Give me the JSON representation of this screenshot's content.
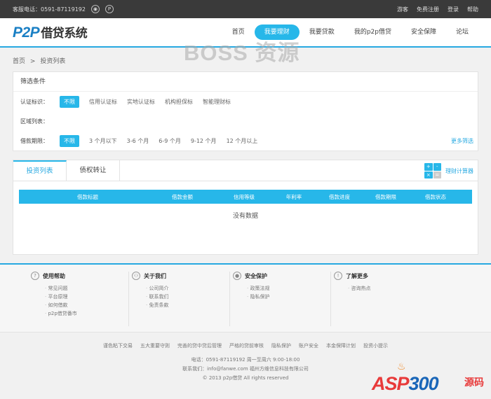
{
  "topbar": {
    "phone": "客服电话：0591-87119192",
    "weibo_icon": "weibo-icon",
    "p_icon": "p-circle-icon",
    "links": [
      "游客",
      "免费注册",
      "登录",
      "帮助"
    ]
  },
  "header": {
    "logo_latin": "P2P",
    "logo_cn": "借贷系统",
    "nav": [
      "首页",
      "我要理财",
      "我要贷款",
      "我的p2p借贷",
      "安全保障",
      "论坛"
    ],
    "active_nav": "我要理财",
    "watermark": "BOSS 资源"
  },
  "breadcrumb": {
    "home": "首页",
    "sep": ">",
    "current": "投资列表"
  },
  "filter": {
    "title": "筛选条件",
    "rows": [
      {
        "label": "认证标识：",
        "options": [
          "不限",
          "信用认证标",
          "实地认证标",
          "机构担保标",
          "智能理财标"
        ]
      },
      {
        "label": "区域列表：",
        "options": []
      },
      {
        "label": "借款期限：",
        "options": [
          "不限",
          "3 个月以下",
          "3-6 个月",
          "6-9 个月",
          "9-12 个月",
          "12 个月以上"
        ]
      }
    ],
    "more": "更多筛选"
  },
  "list": {
    "tabs": [
      "投资列表",
      "债权转让"
    ],
    "calculator": "理财计算器",
    "calc_keys": [
      "+",
      "-",
      "×",
      "="
    ],
    "columns": [
      "借款标题",
      "借款金额",
      "信用等级",
      "年利率",
      "借款进度",
      "借款期限",
      "借款状态"
    ],
    "empty": "没有数据"
  },
  "footer": {
    "columns": [
      {
        "title": "使用帮助",
        "icon": "question-icon",
        "icon_glyph": "?",
        "links": [
          "常见问题",
          "平台原理",
          "如何借款",
          "p2p借贷番市"
        ]
      },
      {
        "title": "关于我们",
        "icon": "user-icon",
        "icon_glyph": "⚇",
        "links": [
          "公司简介",
          "联系我们",
          "免责条款"
        ]
      },
      {
        "title": "安全保护",
        "icon": "shield-icon",
        "icon_glyph": "●",
        "links": [
          "政策法规",
          "隐私保护"
        ]
      },
      {
        "title": "了解更多",
        "icon": "info-icon",
        "icon_glyph": "!",
        "links": [
          "咨询热点"
        ]
      }
    ],
    "bottom_links": [
      "谨色粘下交易",
      "五大重要守则",
      "完善的贷中贷后管理",
      "严格的贷前审核",
      "隐私保护",
      "账户安全",
      "本金保障计划",
      "投资小提示"
    ],
    "phone_line": "电话：0591-87119192 周一至周六 9:00-18:00",
    "contact_line": "联系我们：info@fanwe.com    福州方维信息科技有限公司",
    "copyright": "© 2013 p2p借贷 All rights reserved"
  },
  "badge": {
    "text_a": "ASP",
    "text_b": "300",
    "text_cn": "源码"
  },
  "colors": {
    "accent": "#27b7e9",
    "topbar": "#3a3a3a",
    "logo": "#1a7fc4"
  }
}
